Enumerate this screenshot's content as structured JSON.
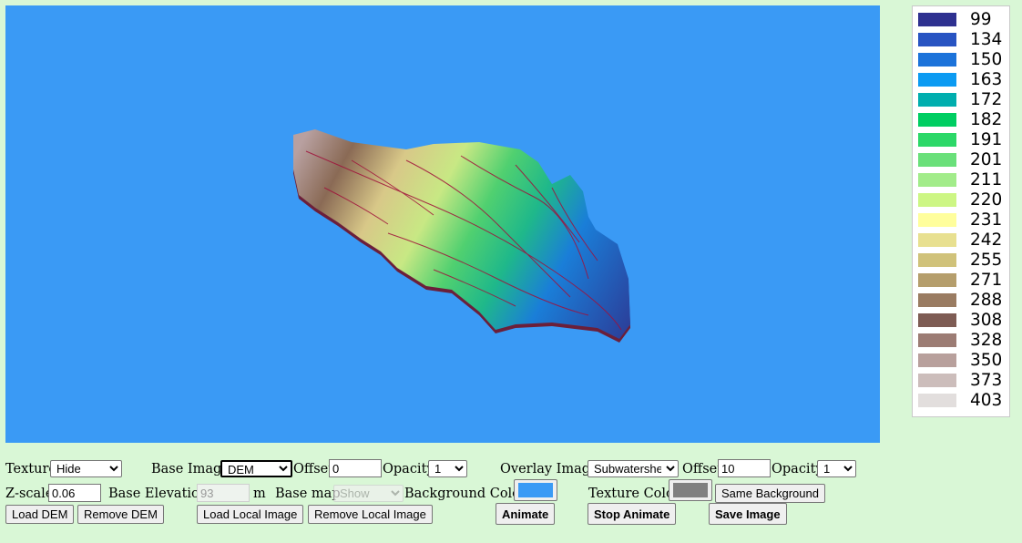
{
  "viewport": {
    "background_color": "#3a9af5",
    "render": "3d-dem-terrain"
  },
  "legend": {
    "entries": [
      {
        "value": "99",
        "color": "#2e3190"
      },
      {
        "value": "134",
        "color": "#2854c2"
      },
      {
        "value": "150",
        "color": "#1c73da"
      },
      {
        "value": "163",
        "color": "#0c9bf2"
      },
      {
        "value": "172",
        "color": "#00aeae"
      },
      {
        "value": "182",
        "color": "#00ce62"
      },
      {
        "value": "191",
        "color": "#2cd868"
      },
      {
        "value": "201",
        "color": "#6ae07a"
      },
      {
        "value": "211",
        "color": "#a2ec8a"
      },
      {
        "value": "220",
        "color": "#cdf684"
      },
      {
        "value": "231",
        "color": "#fffe9c"
      },
      {
        "value": "242",
        "color": "#e8e090"
      },
      {
        "value": "255",
        "color": "#d0c27a"
      },
      {
        "value": "271",
        "color": "#b59e6c"
      },
      {
        "value": "288",
        "color": "#9a7c62"
      },
      {
        "value": "308",
        "color": "#7e5c54"
      },
      {
        "value": "328",
        "color": "#9c7c74"
      },
      {
        "value": "350",
        "color": "#b8a09c"
      },
      {
        "value": "373",
        "color": "#ccbdbb"
      },
      {
        "value": "403",
        "color": "#e2dedd"
      }
    ]
  },
  "controls": {
    "texture": {
      "label": "Texture",
      "value": "Hide"
    },
    "base_image": {
      "label": "Base Image",
      "value": "DEM"
    },
    "base_offset": {
      "label": "Offset",
      "value": "0"
    },
    "base_opacity": {
      "label": "Opacity",
      "value": "1"
    },
    "overlay_image": {
      "label": "Overlay Image",
      "value": "Subwatershe"
    },
    "overlay_offset": {
      "label": "Offset",
      "value": "10"
    },
    "overlay_opacity": {
      "label": "Opacity",
      "value": "1"
    },
    "zscale": {
      "label": "Z-scale",
      "value": "0.06"
    },
    "base_elevation": {
      "label": "Base Elevation",
      "value": "93",
      "unit": "m"
    },
    "base_map": {
      "label": "Base map",
      "value": "Show"
    },
    "background_color": {
      "label": "Background Color",
      "color": "#3a9af5"
    },
    "texture_color": {
      "label": "Texture Color",
      "color": "#808080"
    },
    "same_background": "Same Background",
    "load_dem": "Load DEM",
    "remove_dem": "Remove DEM",
    "load_local_image": "Load Local Image",
    "remove_local_image": "Remove Local Image",
    "animate": "Animate",
    "stop_animate": "Stop Animate",
    "save_image": "Save Image"
  }
}
